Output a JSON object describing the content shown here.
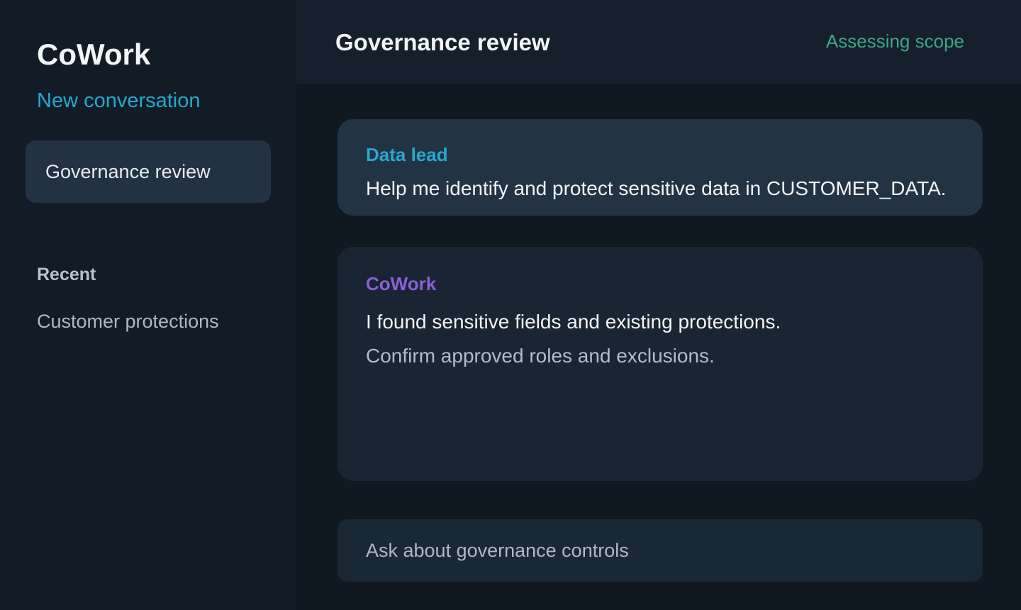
{
  "sidebar": {
    "app_title": "CoWork",
    "new_conversation": "New conversation",
    "active_item": "Governance review",
    "recent_label": "Recent",
    "recent_items": [
      "Customer protections"
    ]
  },
  "header": {
    "title": "Governance review",
    "status": "Assessing scope"
  },
  "messages": [
    {
      "sender": "Data lead",
      "lines": [
        "Help me identify and protect sensitive data in CUSTOMER_DATA."
      ]
    },
    {
      "sender": "CoWork",
      "lines": [
        "I found sensitive fields and existing protections.",
        "Confirm approved roles and exclusions."
      ]
    }
  ],
  "composer": {
    "placeholder": "Ask about governance controls"
  },
  "colors": {
    "accent": "#27a8cf",
    "assistant": "#8b5fd8",
    "status": "#3ea586"
  }
}
